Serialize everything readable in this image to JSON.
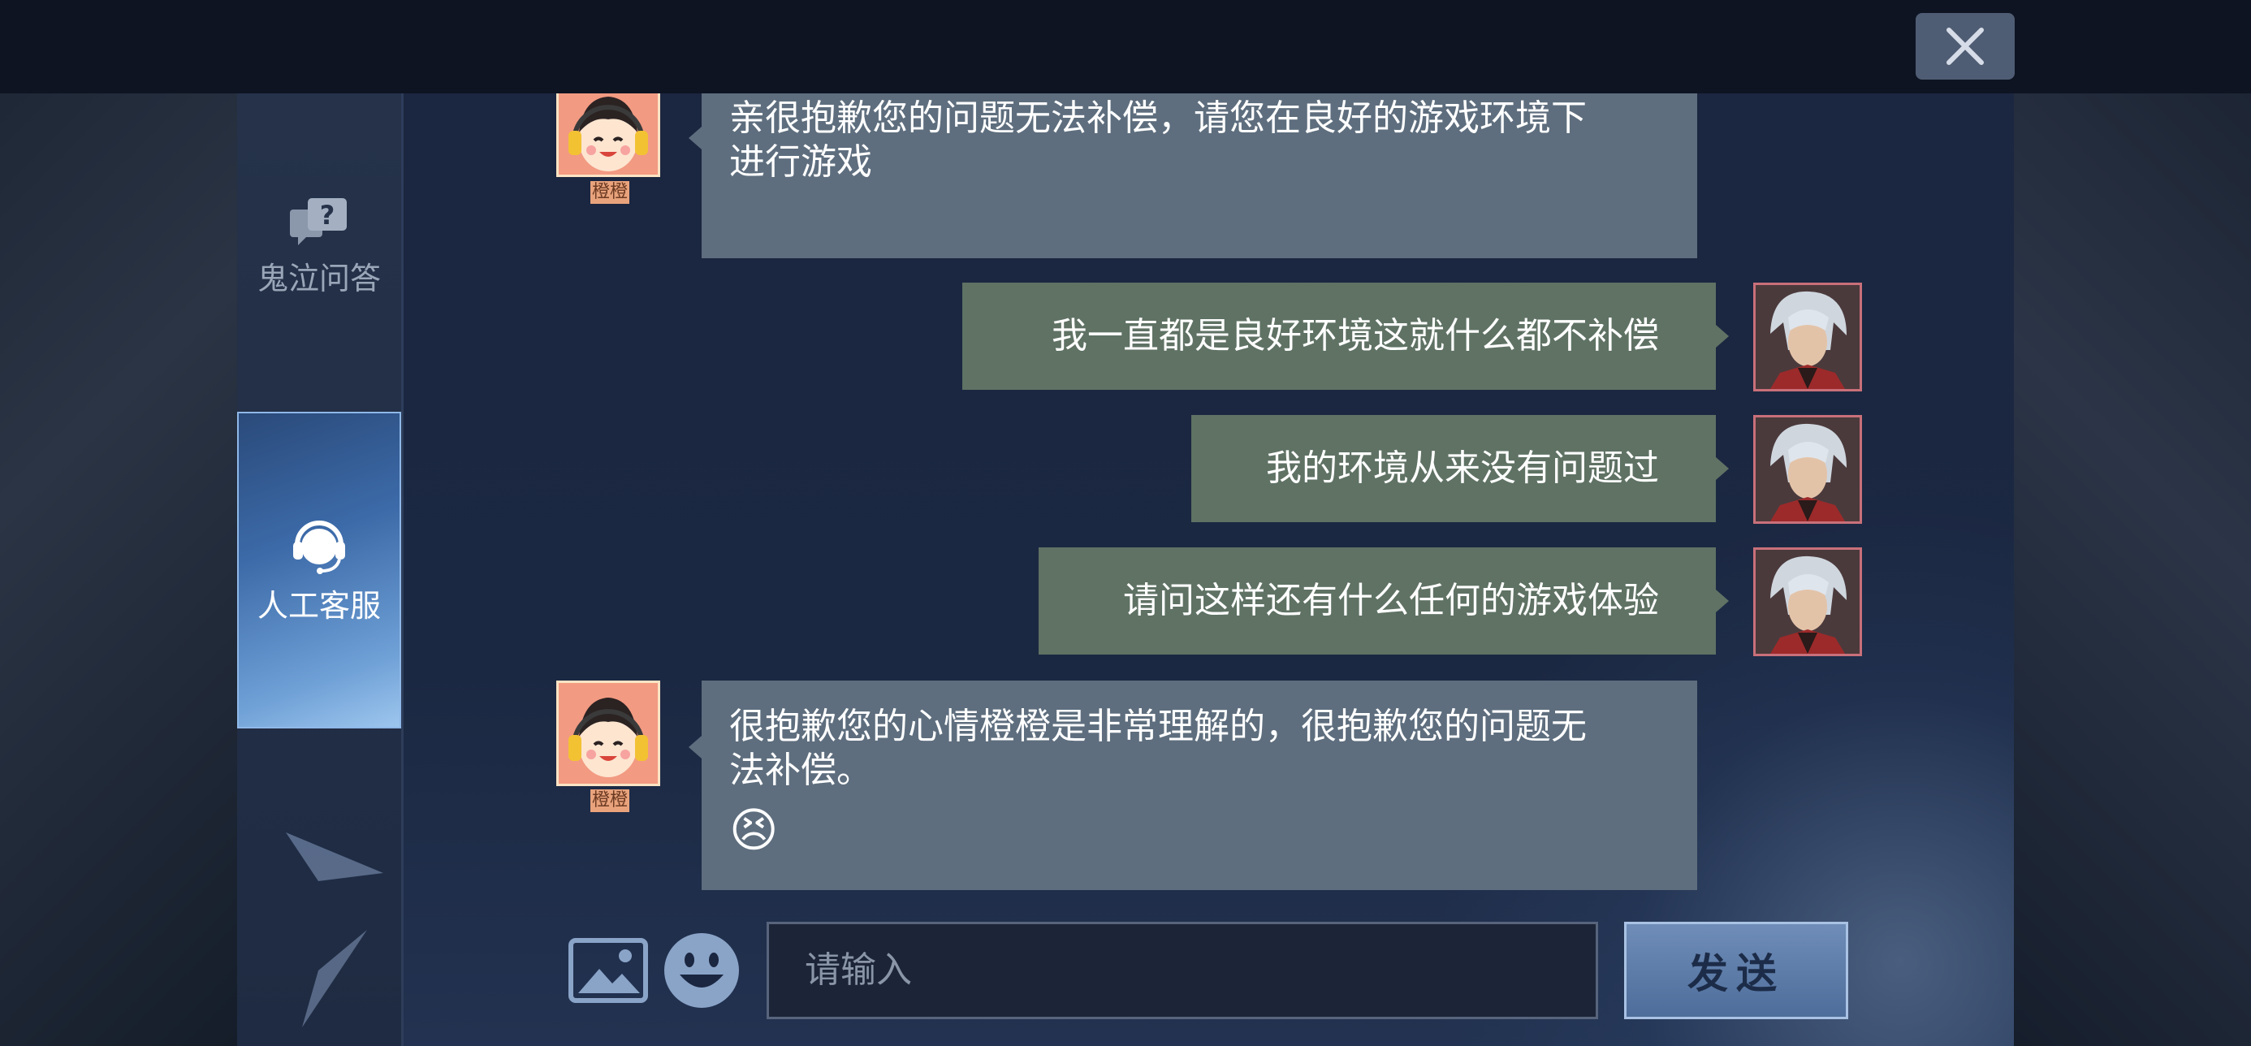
{
  "sidebar": {
    "items": [
      {
        "label": "鬼泣问答",
        "icon": "qa-bubble-icon"
      },
      {
        "label": "人工客服",
        "icon": "headset-icon"
      }
    ]
  },
  "agent": {
    "name": "橙橙"
  },
  "messages": [
    {
      "from": "agent",
      "lines": [
        "亲很抱歉您的问题无法补偿，请您在良好的游戏环境下",
        "进行游戏"
      ]
    },
    {
      "from": "user",
      "text": "我一直都是良好环境这就什么都不补偿"
    },
    {
      "from": "user",
      "text": "我的环境从来没有问题过"
    },
    {
      "from": "user",
      "text": "请问这样还有什么任何的游戏体验"
    },
    {
      "from": "agent",
      "lines": [
        "很抱歉您的心情橙橙是非常理解的，很抱歉您的问题无",
        "法补偿。"
      ],
      "emoji": "😣"
    }
  ],
  "input": {
    "placeholder": "请输入"
  },
  "send_label": "发送",
  "icons": {
    "close": "close-icon",
    "image": "image-icon",
    "emoji": "smiley-icon"
  }
}
